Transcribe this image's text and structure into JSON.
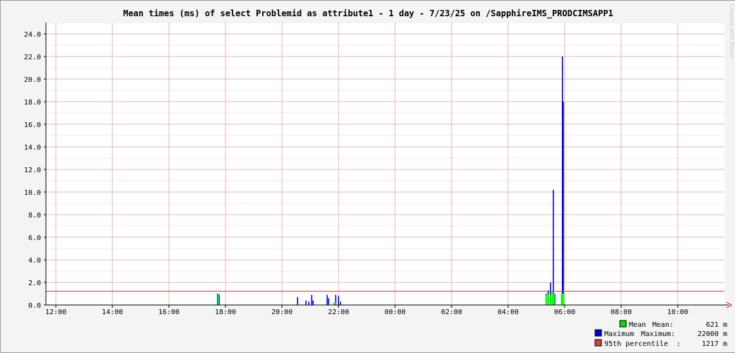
{
  "chart_data": {
    "type": "bar",
    "title": "Mean times (ms) of select Problemid as attribute1 - 1 day - 7/23/25 on /SapphireIMS_PRODCIMSAPP1",
    "watermark": "Created with JRobin",
    "ylim": [
      0,
      25
    ],
    "y_ticks": [
      "0.0",
      "2.0",
      "4.0",
      "6.0",
      "8.0",
      "10.0",
      "12.0",
      "14.0",
      "16.0",
      "18.0",
      "20.0",
      "22.0",
      "24.0"
    ],
    "x_ticks": [
      "12:00",
      "14:00",
      "16:00",
      "18:00",
      "20:00",
      "22:00",
      "00:00",
      "02:00",
      "04:00",
      "06:00",
      "08:00",
      "10:00"
    ],
    "grid": true,
    "legend_position": "bottom-right",
    "percentile_95": 1.217,
    "series": [
      {
        "name": "Mean",
        "color": "#00ff00",
        "points": [
          [
            17.75,
            1.0
          ],
          [
            21.85,
            0.2
          ],
          [
            21.9,
            0.2
          ],
          [
            5.35,
            0.9
          ],
          [
            5.42,
            1.0
          ],
          [
            5.5,
            0.9
          ],
          [
            5.57,
            1.2
          ],
          [
            5.62,
            1.0
          ],
          [
            5.9,
            1.0
          ],
          [
            5.95,
            1.0
          ]
        ]
      },
      {
        "name": "Maximum",
        "color": "#0000ff",
        "points": [
          [
            17.72,
            1.0
          ],
          [
            17.78,
            0.9
          ],
          [
            20.55,
            0.7
          ],
          [
            20.85,
            0.4
          ],
          [
            20.95,
            0.3
          ],
          [
            21.05,
            0.9
          ],
          [
            21.1,
            0.4
          ],
          [
            21.6,
            0.9
          ],
          [
            21.65,
            0.6
          ],
          [
            21.9,
            0.9
          ],
          [
            22.0,
            0.8
          ],
          [
            22.07,
            0.3
          ],
          [
            5.35,
            1.0
          ],
          [
            5.42,
            1.3
          ],
          [
            5.5,
            2.0
          ],
          [
            5.6,
            10.2
          ],
          [
            5.65,
            1.0
          ],
          [
            5.92,
            22.0
          ],
          [
            5.95,
            18.0
          ]
        ]
      }
    ],
    "legend": [
      {
        "name": "Mean",
        "label": "Mean",
        "stat_name": "Mean:",
        "value": "621 m",
        "color": "#00e000"
      },
      {
        "name": "Maximum",
        "label": "Maximum",
        "stat_name": "Maximum:",
        "value": "22000 m",
        "color": "#0000e0"
      },
      {
        "name": "95th percentile",
        "label": "95th percentile",
        "stat_name": ":",
        "value": "1217 m",
        "color": "#d04040"
      }
    ]
  }
}
